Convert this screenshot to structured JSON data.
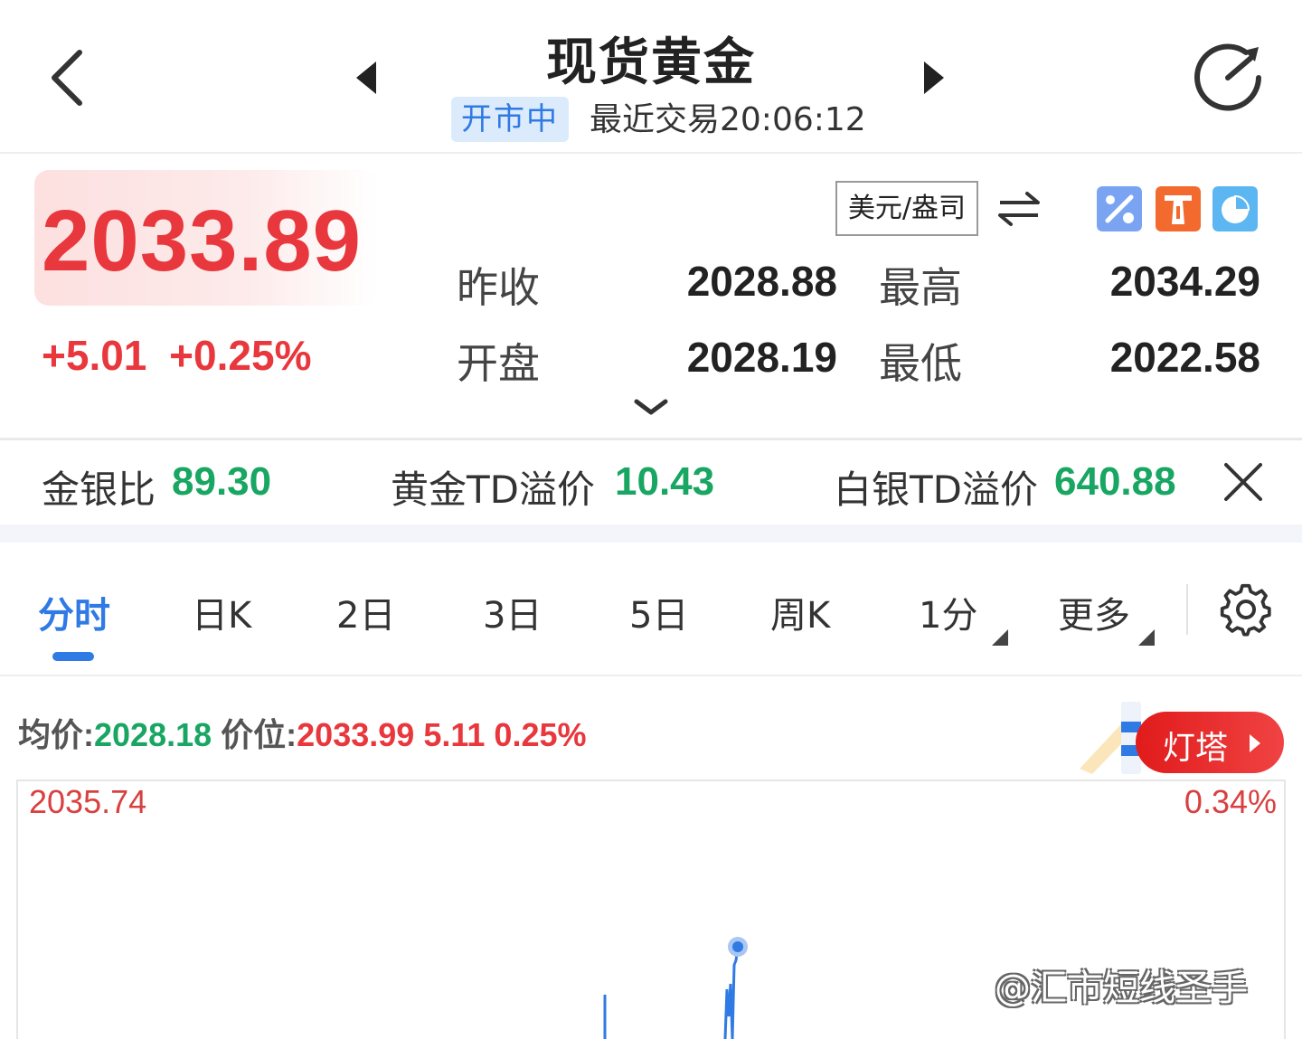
{
  "header": {
    "title": "现货黄金",
    "status": "开市中",
    "last_trade": "最近交易20:06:12"
  },
  "quote": {
    "price": "2033.89",
    "change": "+5.01  +0.25%",
    "unit": "美元/盎司",
    "stats": {
      "prev_close_label": "昨收",
      "prev_close": "2028.88",
      "high_label": "最高",
      "high": "2034.29",
      "open_label": "开盘",
      "open": "2028.19",
      "low_label": "最低",
      "low": "2022.58"
    }
  },
  "ratios": {
    "gold_silver_label": "金银比",
    "gold_silver": "89.30",
    "gold_td_label": "黄金TD溢价",
    "gold_td": "10.43",
    "silver_td_label": "白银TD溢价",
    "silver_td": "640.88"
  },
  "tabs": [
    {
      "label": "分时"
    },
    {
      "label": "日K"
    },
    {
      "label": "2日"
    },
    {
      "label": "3日"
    },
    {
      "label": "5日"
    },
    {
      "label": "周K"
    },
    {
      "label": "1分"
    },
    {
      "label": "更多"
    }
  ],
  "info": {
    "avg_label": "均价:",
    "avg": "2028.18",
    "price_label": "价位:",
    "price": "2033.99",
    "change": "5.11",
    "pct": "0.25%"
  },
  "lighthouse": {
    "label": "灯塔"
  },
  "chart": {
    "max_label": "2035.74",
    "max_pct": "0.34%"
  },
  "watermark": "@汇市短线圣手",
  "colors": {
    "up": "#e8373d",
    "down": "#19a663",
    "accent": "#2f7ae5"
  },
  "icons": {
    "back": "chevron-left-icon",
    "prev": "triangle-left-icon",
    "next": "triangle-right-icon",
    "refresh": "refresh-icon",
    "swap": "swap-arrows-icon",
    "percent": "percent-icon",
    "lighthouse": "lighthouse-icon",
    "pie": "pie-chart-icon",
    "close": "close-icon",
    "settings": "gear-icon"
  }
}
